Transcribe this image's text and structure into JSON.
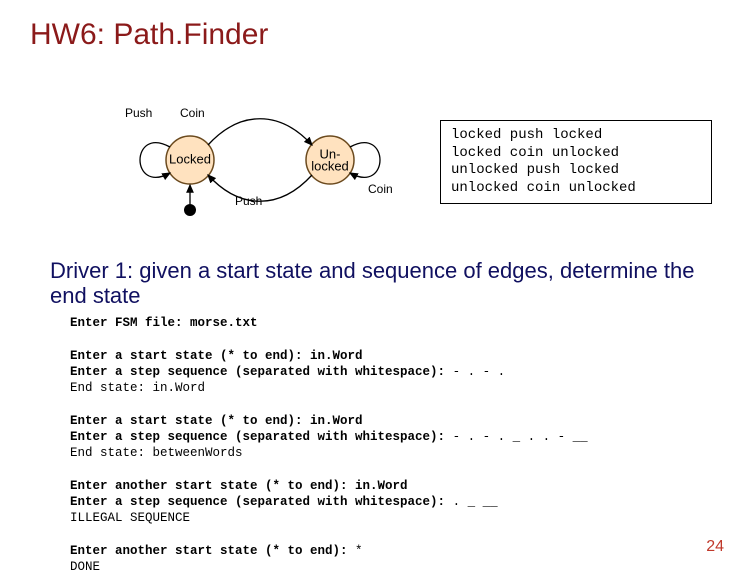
{
  "title": "HW6: Path.Finder",
  "fsm": {
    "state_locked": "Locked",
    "state_unlocked_l1": "Un-",
    "state_unlocked_l2": "locked",
    "label_push_top": "Push",
    "label_coin_top": "Coin",
    "label_push_bottom": "Push",
    "label_coin_bottom": "Coin"
  },
  "transitions": "locked push locked\nlocked coin unlocked\nunlocked push locked\nunlocked coin unlocked",
  "driver_desc": "Driver 1: given a start state and sequence of edges, determine the end state",
  "console": {
    "l1p": "Enter FSM file: ",
    "l1v": "morse.txt",
    "l2p": "Enter a start state (* to end): ",
    "l2v": "in.Word",
    "l3p": "Enter a step sequence (separated with whitespace): ",
    "l3v": "- . - .",
    "l4": "End state: in.Word",
    "l5p": "Enter a start state (* to end): ",
    "l5v": "in.Word",
    "l6p": "Enter a step sequence (separated with whitespace): ",
    "l6v": "- . - . _ . . - __",
    "l7": "End state: betweenWords",
    "l8p": "Enter another start state (* to end): ",
    "l8v": "in.Word",
    "l9p": "Enter a step sequence (separated with whitespace): ",
    "l9v": ". _ __",
    "l10": "ILLEGAL SEQUENCE",
    "l11p": "Enter another start state (* to end): ",
    "l11v": "*",
    "l12": "DONE"
  },
  "page_number": "24"
}
